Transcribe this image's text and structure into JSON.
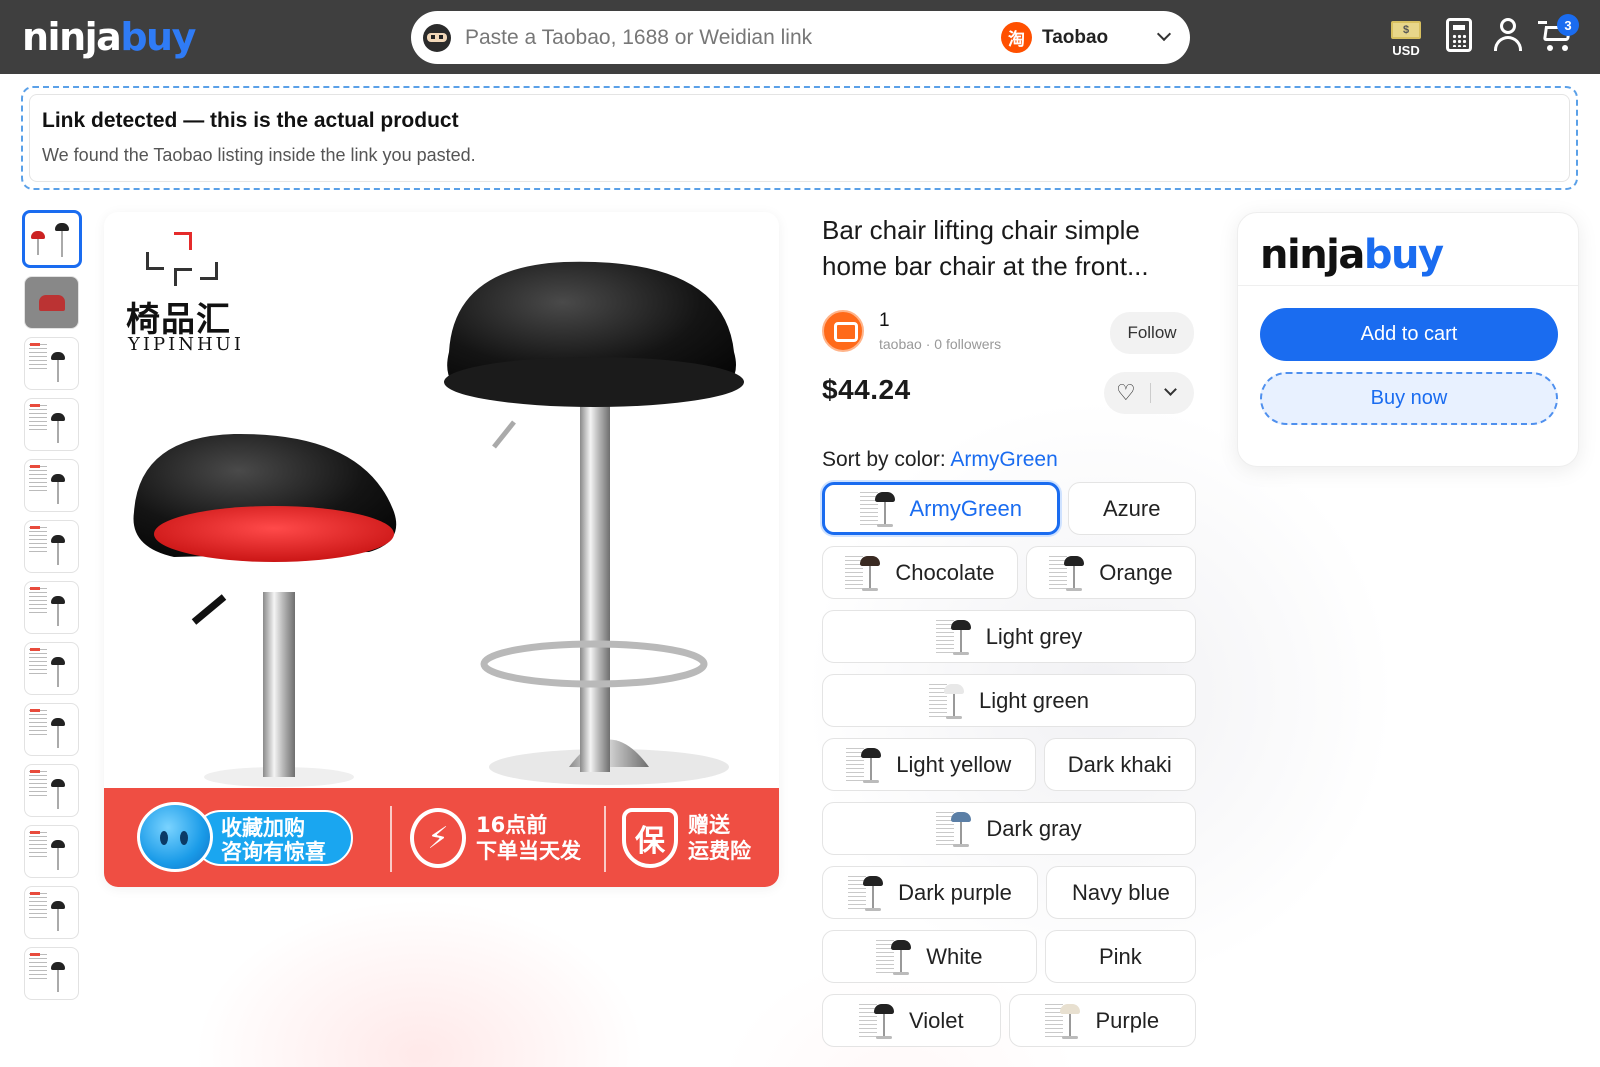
{
  "header": {
    "logo_part1": "ninja",
    "logo_part2": "buy",
    "search_placeholder": "Paste a Taobao, 1688 or Weidian link",
    "platform_label": "Taobao",
    "platform_icon_glyph": "淘",
    "currency_label": "USD",
    "currency_glyph": "$",
    "cart_count": "3",
    "icons": [
      "search-avatar-icon",
      "taobao-icon",
      "chevron-down-icon",
      "currency-icon",
      "calculator-icon",
      "user-icon",
      "cart-icon"
    ]
  },
  "banner": {
    "title": "Link detected — this is the actual product",
    "subtitle": "We found the Taobao listing inside the link you pasted."
  },
  "gallery": {
    "thumbnail_count": 13,
    "active_index": 0
  },
  "main_image": {
    "brand_cn": "椅品汇",
    "brand_en": "YIPINHUI",
    "promo_1": "收藏加购\n咨询有惊喜",
    "promo_2_icon": "⚡",
    "promo_2": "16点前\n下单当天发",
    "promo_3_icon": "保",
    "promo_3": "赠送\n运费险"
  },
  "product": {
    "title": "Bar chair lifting chair simple home bar chair at the front...",
    "seller_name": "1",
    "seller_meta": "taobao · 0 followers",
    "follow_label": "Follow",
    "price": "$44.24",
    "sort_label": "Sort by color:",
    "selected_color": "ArmyGreen",
    "colors": [
      [
        {
          "label": "ArmyGreen",
          "thumb": true,
          "selected": true,
          "seat": "#222"
        },
        {
          "label": "Azure",
          "thumb": false
        }
      ],
      [
        {
          "label": "Chocolate",
          "thumb": true,
          "seat": "#3a2a22"
        },
        {
          "label": "Orange",
          "thumb": true,
          "seat": "#222"
        }
      ],
      [
        {
          "label": "Light grey",
          "thumb": true,
          "seat": "#222"
        }
      ],
      [
        {
          "label": "Light green",
          "thumb": true,
          "seat": "#e8e8e8"
        }
      ],
      [
        {
          "label": "Light yellow",
          "thumb": true,
          "seat": "#222"
        },
        {
          "label": "Dark khaki",
          "thumb": false
        }
      ],
      [
        {
          "label": "Dark gray",
          "thumb": true,
          "seat": "#5b7fa6"
        }
      ],
      [
        {
          "label": "Dark purple",
          "thumb": true,
          "seat": "#222"
        },
        {
          "label": "Navy blue",
          "thumb": false
        }
      ],
      [
        {
          "label": "White",
          "thumb": true,
          "seat": "#222"
        },
        {
          "label": "Pink",
          "thumb": false
        }
      ],
      [
        {
          "label": "Violet",
          "thumb": true,
          "seat": "#222"
        },
        {
          "label": "Purple",
          "thumb": true,
          "seat": "#e8e0d0"
        }
      ]
    ]
  },
  "buybox": {
    "logo_part1": "ninja",
    "logo_part2": "buy",
    "add_to_cart": "Add to cart",
    "buy_now": "Buy now"
  },
  "colors": {
    "accent": "#1a6cf0",
    "header_bg": "#3f3f3f",
    "promo_red": "#ef4e43",
    "taobao_orange": "#ff5000"
  }
}
